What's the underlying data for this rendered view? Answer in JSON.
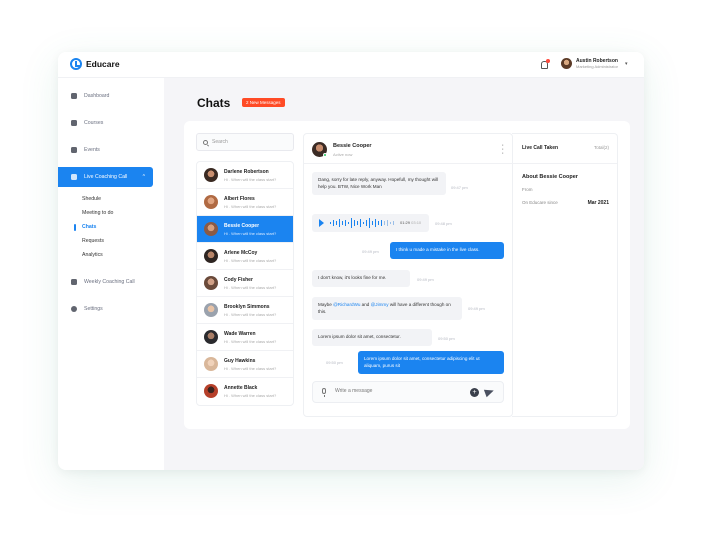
{
  "app": {
    "name": "Educare"
  },
  "user": {
    "name": "Austin Robertson",
    "role": "Marketing Administrator"
  },
  "sidebar": {
    "items": [
      {
        "label": "Dashboard"
      },
      {
        "label": "Courses"
      },
      {
        "label": "Events"
      },
      {
        "label": "Live Coaching Call"
      },
      {
        "label": "Weekly Coaching Call"
      },
      {
        "label": "Settings"
      }
    ],
    "sub_items": [
      {
        "label": "Shedule"
      },
      {
        "label": "Meeting to do"
      },
      {
        "label": "Chats"
      },
      {
        "label": "Requests"
      },
      {
        "label": "Analytics"
      }
    ]
  },
  "page": {
    "title": "Chats",
    "badge": "2 New Messages"
  },
  "search": {
    "placeholder": "Search"
  },
  "contacts": [
    {
      "name": "Darlene Robertson",
      "message": "Hi . When will the class start?",
      "avatar_color": "#3a2a22"
    },
    {
      "name": "Albert Flores",
      "message": "Hi . When will the class start?",
      "avatar_color": "#b06a43"
    },
    {
      "name": "Bessie Cooper",
      "message": "Hi . When will the class start?",
      "avatar_color": "#8b5a44"
    },
    {
      "name": "Arlene McCoy",
      "message": "Hi . When will the class start?",
      "avatar_color": "#2e2522"
    },
    {
      "name": "Cody Fisher",
      "message": "Hi . When will the class start?",
      "avatar_color": "#6a4a3a"
    },
    {
      "name": "Brooklyn Simmons",
      "message": "Hi . When will the class start?",
      "avatar_color": "#9aa2ad"
    },
    {
      "name": "Wade Warren",
      "message": "Hi . When will the class start?",
      "avatar_color": "#2a2a2e"
    },
    {
      "name": "Guy Hawkins",
      "message": "Hi . When will the class start?",
      "avatar_color": "#d9b79a"
    },
    {
      "name": "Annette Black",
      "message": "Hi . When will the class start?",
      "avatar_color": "#b6402a"
    }
  ],
  "chat": {
    "name": "Bessie Cooper",
    "status": "Active now",
    "messages": [
      {
        "text": "Dang, sorry for late reply, anyway. Hopefull, my thought will help you. BTW, Nice Work Man",
        "time": "09:47 pm"
      },
      {
        "voice_duration": "01:29",
        "voice_time": "03:10",
        "time": "09:48 pm"
      },
      {
        "text": "I think u made a mistake in the live class.",
        "time": "09:49 pm"
      },
      {
        "text": "I don't know, it's looks fine for me.",
        "time": "09:49 pm"
      },
      {
        "text_before": "Maybe ",
        "mention1": "@RichardWu",
        "text_mid": " and ",
        "mention2": "@Jimmy",
        "text_after": " will have a different though on this.",
        "time": "09:49 pm"
      },
      {
        "text": "Lorem ipsum dolor sit amet, consectetur.",
        "time": "09:50 pm"
      },
      {
        "text": "Lorem ipsum dolor sit amet, consectetur adipiscing elit ut aliquam, purus sit",
        "time": "09:50 pm"
      }
    ],
    "composer_placeholder": "Write a message"
  },
  "info": {
    "title": "Live Call Taken",
    "total": "Total(2)",
    "about_title": "About Bessie Cooper",
    "from_label": "From",
    "since_label": "On Educare since",
    "since_value": "Mar 2021"
  },
  "colors": {
    "accent": "#1b84f0",
    "badge": "#ff4b26",
    "online": "#22c55e"
  }
}
